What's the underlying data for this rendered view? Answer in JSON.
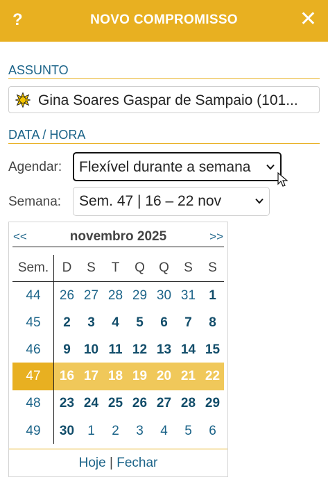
{
  "header": {
    "help_label": "?",
    "title": "NOVO COMPROMISSO",
    "close_label": "✕"
  },
  "subject": {
    "section_title": "ASSUNTO",
    "value": "Gina Soares Gaspar de Sampaio (101...",
    "icon": "sun-icon"
  },
  "datetime": {
    "section_title": "DATA / HORA",
    "schedule_label": "Agendar:",
    "schedule_value": "Flexível durante a semana",
    "week_label": "Semana:",
    "week_value": "Sem. 47 | 16 – 22 nov"
  },
  "calendar": {
    "prev_label": "<<",
    "next_label": ">>",
    "month_title": "novembro 2025",
    "week_header": "Sem.",
    "day_headers": [
      "D",
      "S",
      "T",
      "Q",
      "Q",
      "S",
      "S"
    ],
    "weeks": [
      {
        "num": "44",
        "days": [
          "26",
          "27",
          "28",
          "29",
          "30",
          "31",
          "1"
        ]
      },
      {
        "num": "45",
        "days": [
          "2",
          "3",
          "4",
          "5",
          "6",
          "7",
          "8"
        ]
      },
      {
        "num": "46",
        "days": [
          "9",
          "10",
          "11",
          "12",
          "13",
          "14",
          "15"
        ]
      },
      {
        "num": "47",
        "days": [
          "16",
          "17",
          "18",
          "19",
          "20",
          "21",
          "22"
        ]
      },
      {
        "num": "48",
        "days": [
          "23",
          "24",
          "25",
          "26",
          "27",
          "28",
          "29"
        ]
      },
      {
        "num": "49",
        "days": [
          "30",
          "1",
          "2",
          "3",
          "4",
          "5",
          "6"
        ]
      }
    ],
    "selected_week": "47",
    "today_label": "Hoje",
    "separator": "|",
    "close_label": "Fechar"
  },
  "colors": {
    "accent": "#e8b021",
    "highlight": "#f0c85a",
    "link": "#1c6489"
  }
}
